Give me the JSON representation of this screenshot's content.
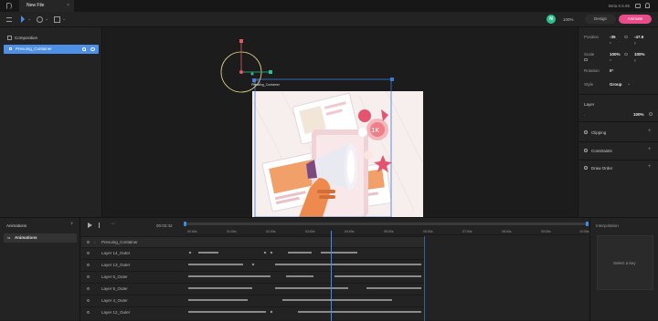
{
  "app": {
    "tab_title": "New File",
    "version": "Beta 0.6.95",
    "tab_close": "×"
  },
  "toolbar": {
    "zoom": "100%",
    "design_label": "Design",
    "animate_label": "Animate",
    "avatar_initial": "N"
  },
  "left": {
    "composition_label": "Composition",
    "layer_item": "Prevuing_Container"
  },
  "canvas": {
    "selection_label": "Prevuing_Container"
  },
  "right": {
    "position_label": "Position",
    "position_x": "-35",
    "position_x_unit": "x",
    "position_y": "-47.6",
    "position_y_unit": "y",
    "scale_label": "Scale",
    "scale_x": "100%",
    "scale_x_unit": "x",
    "scale_y": "100%",
    "scale_y_unit": "y",
    "rotation_label": "Rotation",
    "rotation_value": "0°",
    "style_label": "Style",
    "style_value": "Group",
    "layer_label": "Layer",
    "layer_opacity": "100%",
    "clipping_label": "Clipping",
    "constraints_label": "Constraints",
    "draworder_label": "Draw Order"
  },
  "timeline": {
    "animations_label": "Animations",
    "animation_item": "Animations",
    "time": "00:02:42",
    "ticks": [
      "00:00s",
      "01:00s",
      "02:00s",
      "03:00s",
      "04:00s",
      "05:00s",
      "06:00s",
      "07:00s",
      "08:00s",
      "09:00s",
      "10:00s"
    ],
    "group_row": "Prevuing_Container",
    "layers": [
      "Layer 14_Outer",
      "Layer 13_Outer",
      "Layer 6_Outer",
      "Layer 5_Outer",
      "Layer 4_Outer",
      "Layer 12_Outer"
    ],
    "interpolation_label": "Interpolation",
    "select_key": "Select a key"
  },
  "colors": {
    "accent_pink": "#e84c8a",
    "avatar_green": "#2fbf8f",
    "selection_blue": "#3d7bd9",
    "playhead_blue": "#3c8ee8"
  }
}
